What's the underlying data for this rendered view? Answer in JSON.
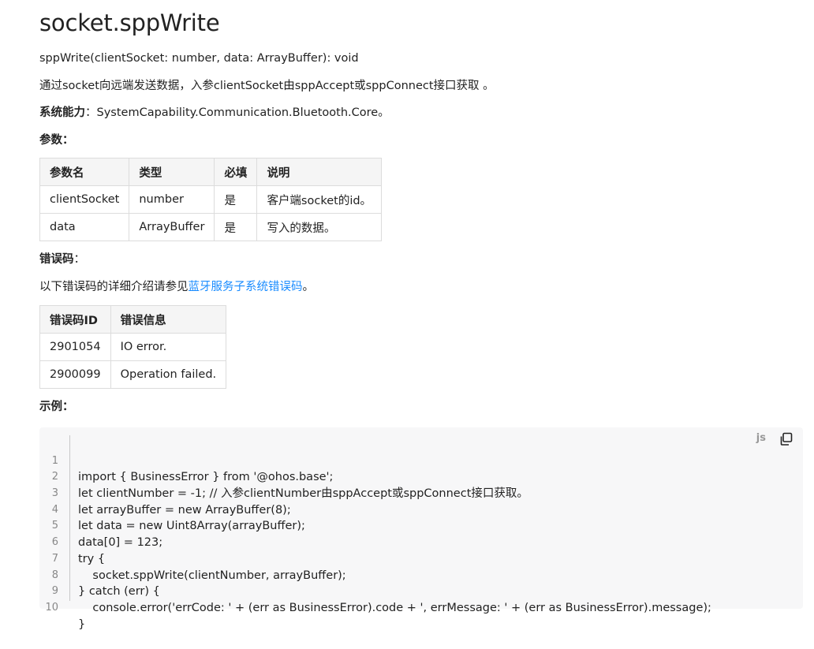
{
  "title": "socket.sppWrite",
  "signature": "sppWrite(clientSocket: number, data: ArrayBuffer): void",
  "description": "通过socket向远端发送数据，入参clientSocket由sppAccept或sppConnect接口获取 。",
  "capability": {
    "label": "系统能力",
    "sep": "：",
    "value": "SystemCapability.Communication.Bluetooth.Core。"
  },
  "params_heading": "参数：",
  "params_table": {
    "headers": [
      "参数名",
      "类型",
      "必填",
      "说明"
    ],
    "rows": [
      [
        "clientSocket",
        "number",
        "是",
        "客户端socket的id。"
      ],
      [
        "data",
        "ArrayBuffer",
        "是",
        "写入的数据。"
      ]
    ]
  },
  "errors_heading": {
    "label": "错误码",
    "sep": "："
  },
  "errors_intro": {
    "prefix": "以下错误码的详细介绍请参见",
    "link": "蓝牙服务子系统错误码",
    "suffix": "。"
  },
  "errors_table": {
    "headers": [
      "错误码ID",
      "错误信息"
    ],
    "rows": [
      [
        "2901054",
        "IO error."
      ],
      [
        "2900099",
        "Operation failed."
      ]
    ]
  },
  "example_heading": "示例：",
  "code": {
    "lang": "js",
    "line_numbers": [
      "1",
      "2",
      "3",
      "4",
      "5",
      "6",
      "7",
      "8",
      "9",
      "10"
    ],
    "lines": [
      "import { BusinessError } from '@ohos.base';",
      "let clientNumber = -1; // 入参clientNumber由sppAccept或sppConnect接口获取。",
      "let arrayBuffer = new ArrayBuffer(8);",
      "let data = new Uint8Array(arrayBuffer);",
      "data[0] = 123;",
      "try {",
      "    socket.sppWrite(clientNumber, arrayBuffer);",
      "} catch (err) {",
      "    console.error('errCode: ' + (err as BusinessError).code + ', errMessage: ' + (err as BusinessError).message);",
      "}"
    ]
  }
}
